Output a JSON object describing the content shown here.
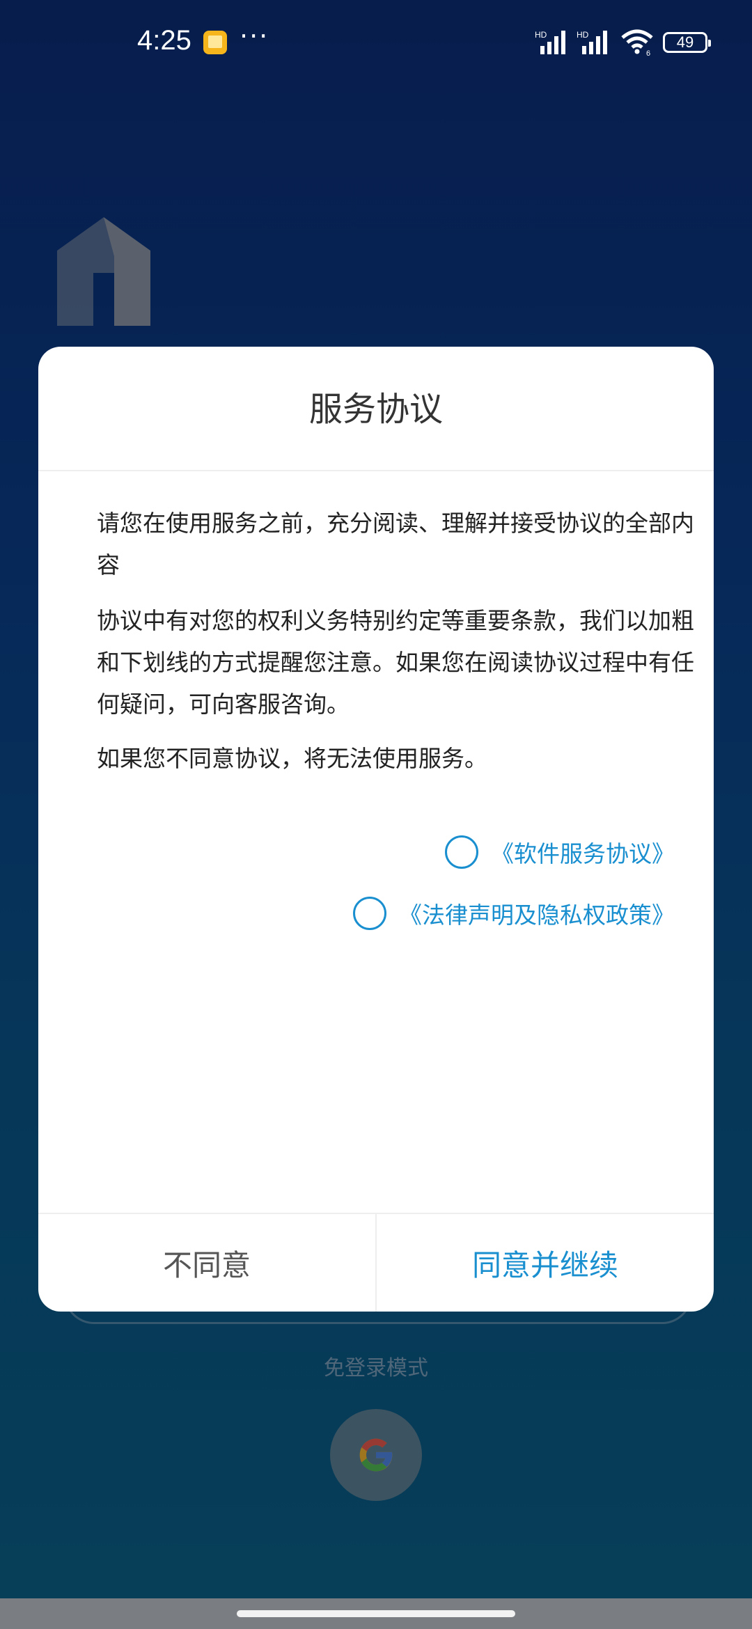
{
  "status_bar": {
    "time": "4:25",
    "more": "···",
    "battery": "49",
    "signal1_label": "HD",
    "signal2_label": "HD",
    "wifi_label": "6"
  },
  "background": {
    "guest_mode": "免登录模式",
    "google_icon": "google-icon"
  },
  "dialog": {
    "title": "服务协议",
    "paragraph1": "请您在使用服务之前，充分阅读、理解并接受协议的全部内容",
    "paragraph2": "协议中有对您的权利义务特别约定等重要条款，我们以加粗和下划线的方式提醒您注意。如果您在阅读协议过程中有任何疑问，可向客服咨询。",
    "paragraph3": "如果您不同意协议，将无法使用服务。",
    "agreements": [
      {
        "label": "《软件服务协议》",
        "checked": false
      },
      {
        "label": "《法律声明及隐私权政策》",
        "checked": false
      }
    ],
    "disagree_label": "不同意",
    "agree_label": "同意并继续"
  },
  "colors": {
    "accent": "#1a8fd0",
    "background_top": "#0b2a6e",
    "background_bottom": "#0b5a7f"
  }
}
